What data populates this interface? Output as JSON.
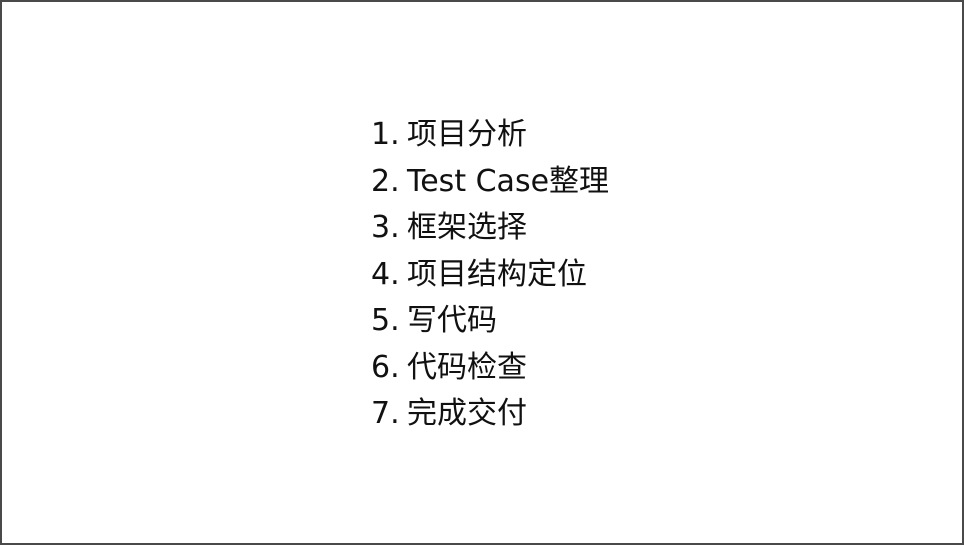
{
  "slide": {
    "steps": [
      {
        "number": "1.",
        "label": "项目分析"
      },
      {
        "number": "2.",
        "label": "Test Case整理"
      },
      {
        "number": "3.",
        "label": "框架选择"
      },
      {
        "number": "4.",
        "label": "项目结构定位"
      },
      {
        "number": "5.",
        "label": "写代码"
      },
      {
        "number": "6.",
        "label": "代码检查"
      },
      {
        "number": "7.",
        "label": "完成交付"
      }
    ]
  },
  "colors": {
    "border": "#4a4a4a",
    "text": "#111111",
    "background": "#ffffff"
  }
}
